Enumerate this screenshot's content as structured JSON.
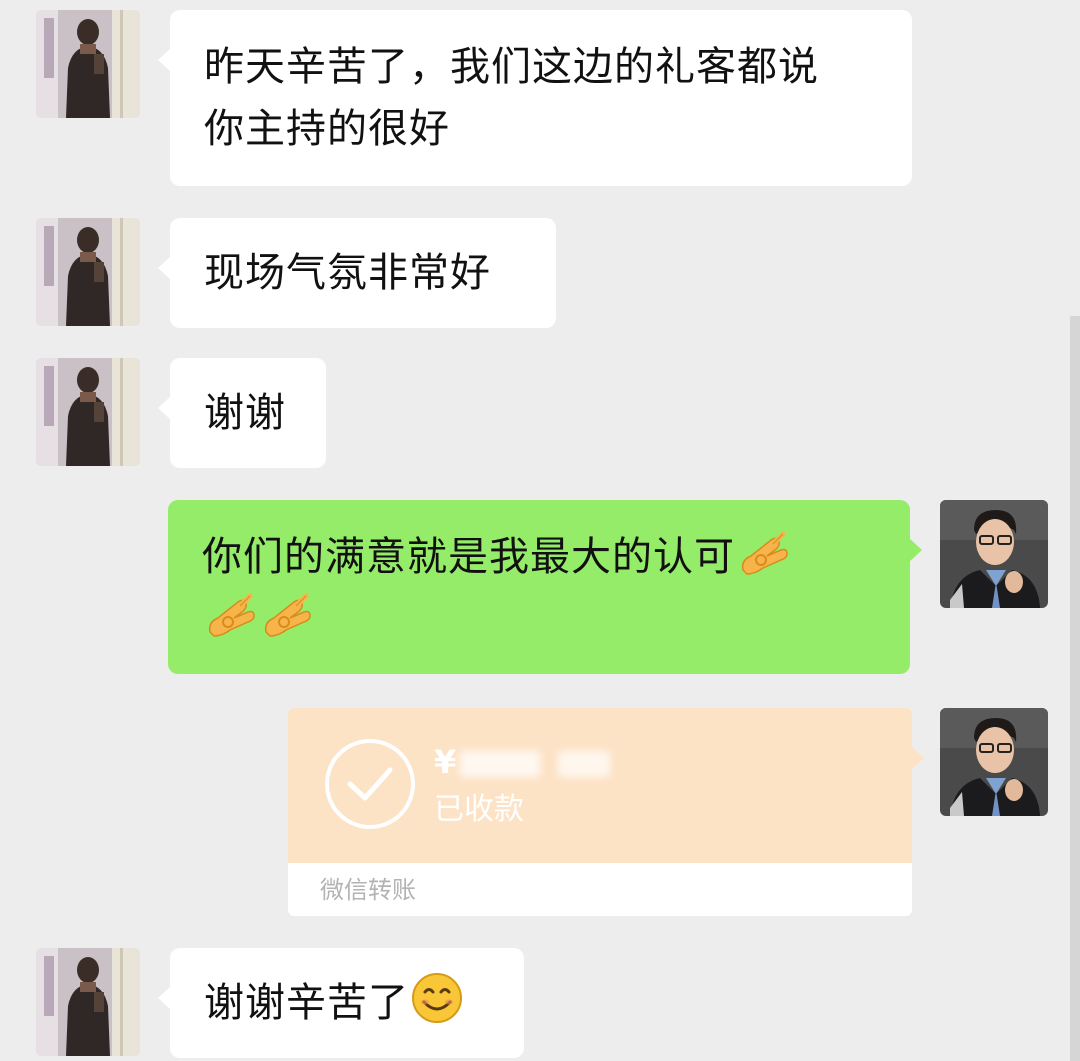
{
  "chat": {
    "msg1": {
      "line1": "昨天辛苦了，我们这边的礼客都说",
      "line2": "你主持的很好"
    },
    "msg2": {
      "text": "现场气氛非常好"
    },
    "msg3": {
      "text": "谢谢"
    },
    "msg4": {
      "text": "你们的满意就是我最大的认可",
      "emoji": "ok-hand-emoji"
    },
    "transfer": {
      "currency": "¥",
      "status": "已收款",
      "label": "微信转账",
      "color": "#fde3c6"
    },
    "msg6": {
      "text": "谢谢辛苦了",
      "emoji": "smile-emoji"
    }
  },
  "colors": {
    "background": "#ededed",
    "incoming_bubble": "#ffffff",
    "outgoing_bubble": "#95ec69",
    "transfer_card": "#fde3c6"
  }
}
